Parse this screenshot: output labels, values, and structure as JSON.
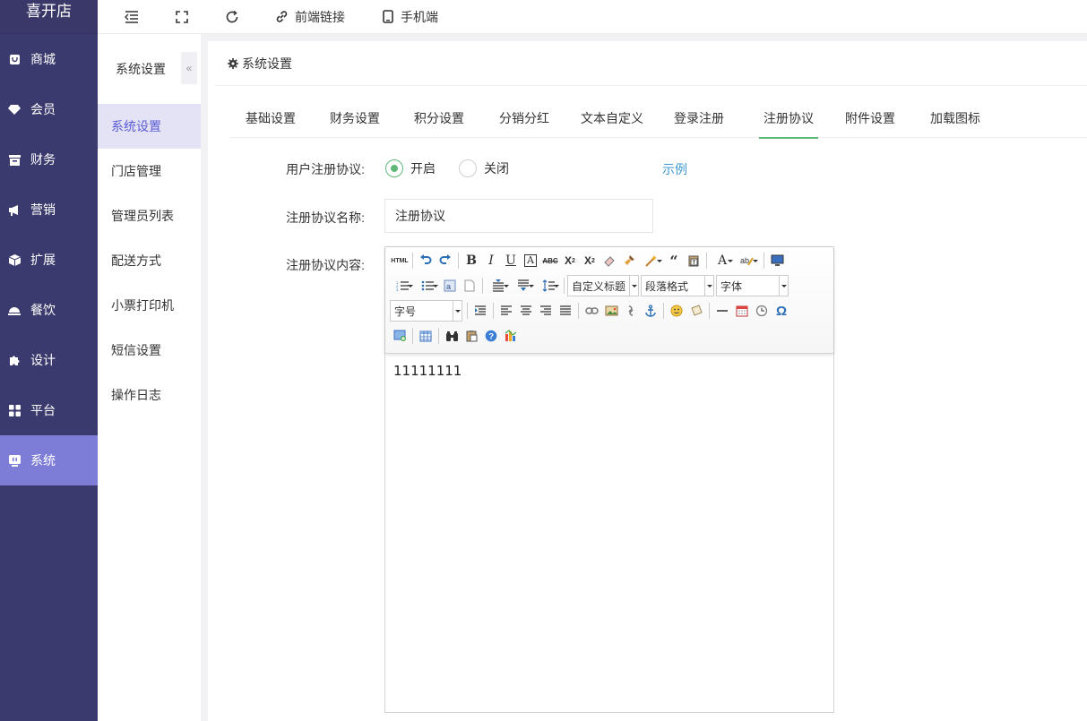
{
  "brand": "喜开店",
  "sidebar": {
    "items": [
      {
        "label": "商城",
        "icon": "store-icon"
      },
      {
        "label": "会员",
        "icon": "member-icon"
      },
      {
        "label": "财务",
        "icon": "finance-icon"
      },
      {
        "label": "营销",
        "icon": "megaphone-icon"
      },
      {
        "label": "扩展",
        "icon": "cube-icon"
      },
      {
        "label": "餐饮",
        "icon": "dining-icon"
      },
      {
        "label": "设计",
        "icon": "puzzle-icon"
      },
      {
        "label": "平台",
        "icon": "grid-icon"
      },
      {
        "label": "系统",
        "icon": "monitor-icon",
        "active": true
      }
    ]
  },
  "topbar": {
    "frontend_link": "前端链接",
    "mobile": "手机端"
  },
  "subnav": {
    "title": "系统设置",
    "collapse": "«",
    "items": [
      "系统设置",
      "门店管理",
      "管理员列表",
      "配送方式",
      "小票打印机",
      "短信设置",
      "操作日志"
    ]
  },
  "main": {
    "header": "系统设置",
    "tabs": [
      "基础设置",
      "财务设置",
      "积分设置",
      "分销分红",
      "文本自定义",
      "登录注册",
      "注册协议",
      "附件设置",
      "加载图标"
    ],
    "active_tab": "注册协议"
  },
  "form": {
    "agreement_label": "用户注册协议:",
    "option_on": "开启",
    "option_off": "关闭",
    "example": "示例",
    "name_label": "注册协议名称:",
    "name_value": "注册协议",
    "content_label": "注册协议内容:"
  },
  "editor": {
    "html_btn": "HTML",
    "custom_title": "自定义标题",
    "paragraph": "段落格式",
    "font_family": "字体",
    "font_size": "字号",
    "content": "11111111"
  },
  "colors": {
    "sidebar_bg": "#3b3a6e",
    "sidebar_active": "#7d7dd8",
    "accent_green": "#5fb878",
    "link_blue": "#3f9ad2"
  }
}
